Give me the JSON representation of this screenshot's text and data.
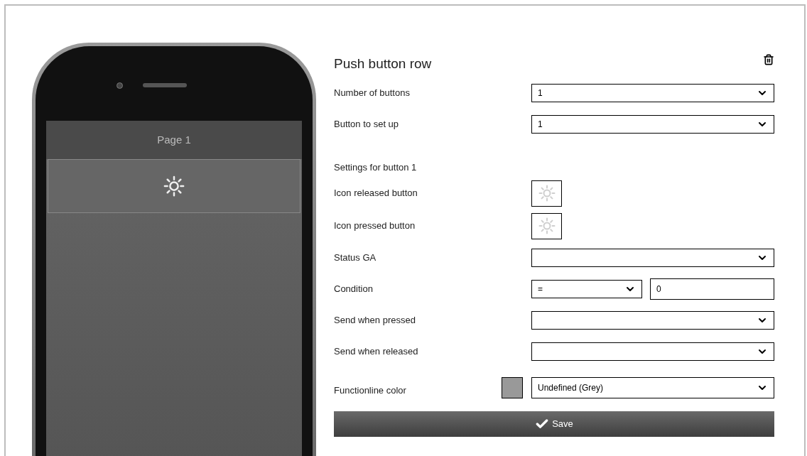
{
  "phone": {
    "page_title": "Page 1"
  },
  "panel": {
    "title": "Push button row",
    "rows": [
      {
        "kind": "select",
        "label": "Number of buttons",
        "value": "1"
      },
      {
        "kind": "select",
        "label": "Button to set up",
        "value": "1"
      },
      {
        "kind": "heading",
        "label": "Settings for button 1"
      },
      {
        "kind": "icon",
        "label": "Icon released button"
      },
      {
        "kind": "icon",
        "label": "Icon pressed button"
      },
      {
        "kind": "select",
        "label": "Status GA"
      },
      {
        "kind": "condition",
        "label": "Condition",
        "operator": "=",
        "value": "0"
      },
      {
        "kind": "select",
        "label": "Send when pressed"
      },
      {
        "kind": "select",
        "label": "Send when released"
      },
      {
        "kind": "color_select",
        "label": "Functionline color",
        "color": "#999999",
        "value": "Undefined (Grey)"
      }
    ],
    "save_label": "Save"
  }
}
